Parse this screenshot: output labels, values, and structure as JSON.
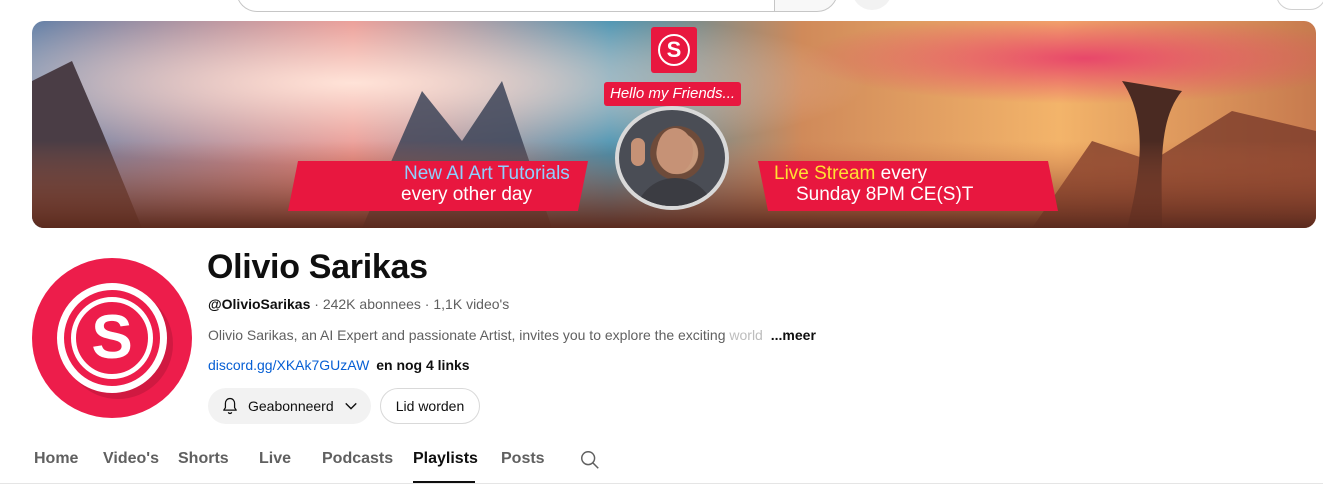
{
  "banner": {
    "hello_text": "Hello my Friends...",
    "left_line1": "New AI Art Tutorials",
    "left_line2": "every other day",
    "right_highlight": "Live Stream",
    "right_line1_rest": " every",
    "right_line2": "Sunday 8PM CE(S)T",
    "logo_letter": "S"
  },
  "channel": {
    "name": "Olivio Sarikas",
    "handle": "@OlivioSarikas",
    "separator": " · ",
    "subscribers": "242K abonnees",
    "videos": "1,1K video's",
    "description": "Olivio Sarikas, an AI Expert and passionate Artist, invites you to explore the exciting ",
    "description_fade": "world",
    "more_label": "...meer",
    "link": "discord.gg/XKAk7GUzAW",
    "more_links": "en nog 4 links",
    "avatar_letter": "S",
    "brand_color": "#ed1d4b"
  },
  "actions": {
    "subscribe_label": "Geabonneerd",
    "join_label": "Lid worden"
  },
  "tabs": [
    {
      "label": "Home"
    },
    {
      "label": "Video's"
    },
    {
      "label": "Shorts"
    },
    {
      "label": "Live"
    },
    {
      "label": "Podcasts"
    },
    {
      "label": "Playlists",
      "active": true
    },
    {
      "label": "Posts"
    }
  ],
  "icons": {
    "subscribe_icon": "bell-icon",
    "dropdown_icon": "chevron-down-icon",
    "tab_search_icon": "search-icon"
  }
}
